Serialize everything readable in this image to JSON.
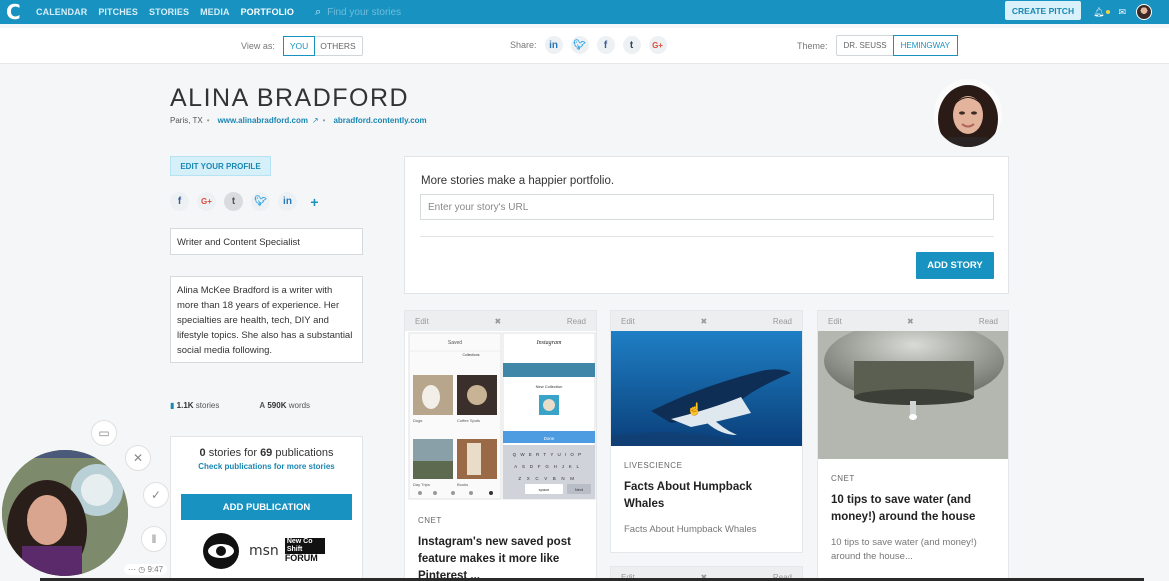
{
  "nav": {
    "logo": "C",
    "links": [
      "CALENDAR",
      "PITCHES",
      "STORIES",
      "MEDIA",
      "PORTFOLIO"
    ],
    "search_placeholder": "Find your stories",
    "create_pitch": "CREATE PITCH"
  },
  "subbar": {
    "view_as_label": "View as:",
    "view_as_options": [
      "YOU",
      "OTHERS"
    ],
    "share_label": "Share:",
    "share_icons": [
      "in",
      "t",
      "f",
      "t",
      "G+"
    ],
    "theme_label": "Theme:",
    "theme_options": [
      "DR. SEUSS",
      "HEMINGWAY"
    ]
  },
  "profile": {
    "name": "ALINA BRADFORD",
    "location": "Paris, TX",
    "website": "www.alinabradford.com",
    "contently": "abradford.contently.com",
    "edit_profile": "EDIT YOUR PROFILE",
    "social_icons": [
      "f",
      "G+",
      "t",
      "t",
      "in",
      "+"
    ],
    "title": "Writer and Content Specialist",
    "bio": "Alina McKee Bradford is a writer with more than 18 years of experience. Her specialties are health, tech, DIY and lifestyle topics. She also has a substantial social media following.",
    "stories_count": "1.1K",
    "stories_label": "stories",
    "words_count": "590K",
    "words_label": "words"
  },
  "publications": {
    "summary_pre": "0",
    "summary_mid": "stories for",
    "summary_count": "69",
    "summary_post": "publications",
    "check_link": "Check publications for more stories",
    "add_button": "ADD PUBLICATION",
    "logos": [
      "msn",
      "New Co Shift",
      "FORUM"
    ]
  },
  "add_story": {
    "lead": "More stories make a happier portfolio.",
    "placeholder": "Enter your story's URL",
    "button": "ADD STORY"
  },
  "cards": [
    {
      "edit": "Edit",
      "remove": "✖",
      "read": "Read",
      "source": "CNET",
      "title": "Instagram's new saved post feature makes it more like Pinterest ..."
    },
    {
      "edit": "Edit",
      "remove": "✖",
      "read": "Read",
      "source": "LIVESCIENCE",
      "title": "Facts About Humpback Whales",
      "desc": "Facts About Humpback Whales"
    },
    {
      "edit": "Edit",
      "remove": "✖",
      "read": "Read",
      "source": "CNET",
      "title": "10 tips to save water (and money!) around the house",
      "desc": "10 tips to save water (and money!) around the house..."
    }
  ],
  "card_bottom": {
    "edit": "Edit",
    "remove": "✖",
    "read": "Read"
  },
  "video": {
    "time": "9:47"
  },
  "phone_mock": {
    "app_name": "Instagram",
    "saved": "Saved",
    "new_collection": "New Collection",
    "collections": "Collections",
    "done": "Done",
    "grid_labels": [
      "Dogs",
      "Coffee Spots",
      "Day Trips",
      "Books"
    ],
    "keyboard_rows": [
      "QWERTYUIOP",
      "ASDFGHJKL",
      "ZXCVBNM"
    ],
    "space": "space",
    "next": "Next"
  }
}
